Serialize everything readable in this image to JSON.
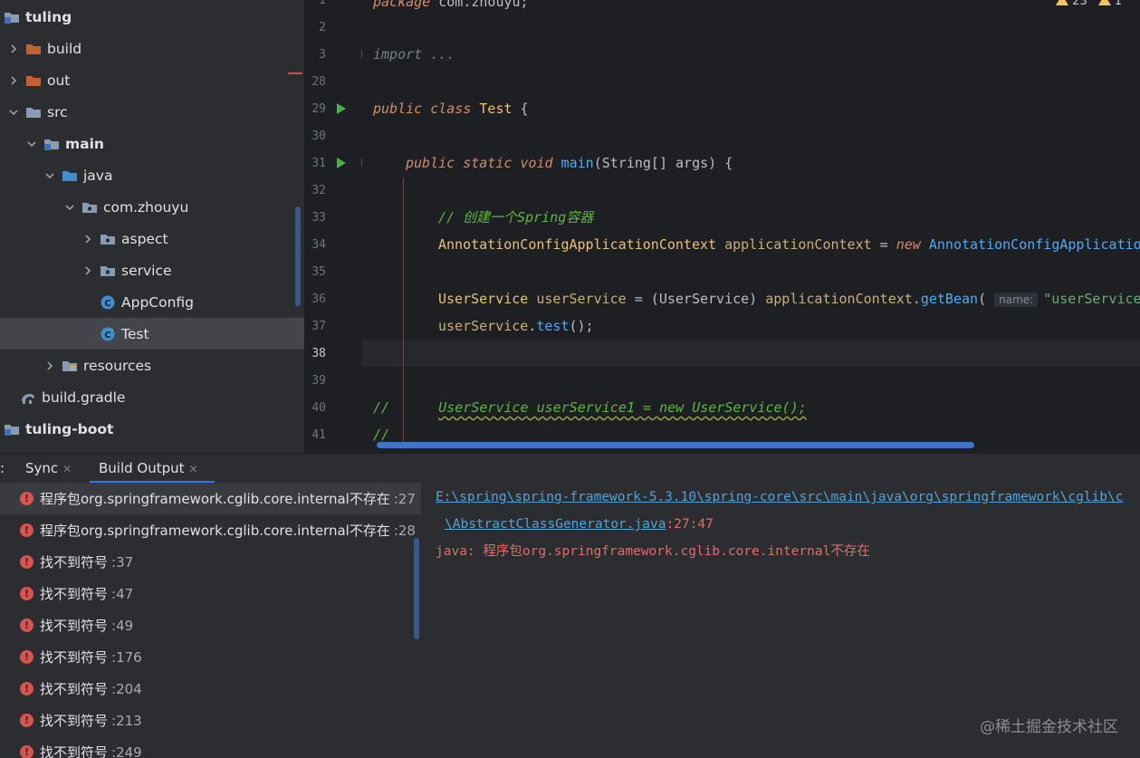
{
  "project_tree": {
    "items": [
      {
        "label": "tuling",
        "icon": "module-folder-icon"
      },
      {
        "label": "build",
        "icon": "excluded-folder-icon"
      },
      {
        "label": "out",
        "icon": "excluded-folder-icon"
      },
      {
        "label": "src",
        "icon": "folder-icon"
      },
      {
        "label": "main",
        "icon": "module-folder-icon"
      },
      {
        "label": "java",
        "icon": "source-folder-icon"
      },
      {
        "label": "com.zhouyu",
        "icon": "package-icon"
      },
      {
        "label": "aspect",
        "icon": "package-icon"
      },
      {
        "label": "service",
        "icon": "package-icon"
      },
      {
        "label": "AppConfig",
        "icon": "java-class-icon"
      },
      {
        "label": "Test",
        "icon": "java-class-icon"
      },
      {
        "label": "resources",
        "icon": "resources-folder-icon"
      },
      {
        "label": "build.gradle",
        "icon": "gradle-icon"
      },
      {
        "label": "tuling-boot",
        "icon": "module-folder-icon"
      }
    ]
  },
  "editor": {
    "line_numbers": [
      "1",
      "2",
      "3",
      "28",
      "29",
      "30",
      "31",
      "32",
      "33",
      "34",
      "35",
      "36",
      "37",
      "38",
      "39",
      "40",
      "41"
    ],
    "warnings": {
      "warning_count": "23",
      "weak_warning_count": "1"
    },
    "code": {
      "l1_kw": "package",
      "l1_rest": " com.zhouyu;",
      "l3_import": "import ...",
      "l29_kw1": "public",
      "l29_kw2": "class",
      "l29_cls": "Test",
      "l29_rest": " {",
      "l31_kw1": "public",
      "l31_kw2": "static",
      "l31_kw3": "void",
      "l31_fn": "main",
      "l31_rest": "(String[] args) {",
      "l33_comment": "// 创建一个Spring容器",
      "l34_cls": "AnnotationConfigApplicationContext",
      "l34_var": "applicationContext",
      "l34_eq": " = ",
      "l34_new": "new",
      "l34_cls2": "AnnotationConfigApplicatio",
      "l36_cls": "UserService",
      "l36_var": "userService",
      "l36_cast": " = (UserService) ",
      "l36_ctx": "applicationContext",
      "l36_dot": ".",
      "l36_fn": "getBean",
      "l36_paren": "(",
      "l36_hint": "name:",
      "l36_str": "\"userService\"",
      "l37_var": "userService",
      "l37_dot": ".",
      "l37_fn": "test",
      "l37_rest": "();",
      "l40_slashes": "//",
      "l40_code": "UserService userService1 = new UserService();",
      "l41_slashes": "//"
    }
  },
  "tool_window": {
    "tabs": [
      {
        "label": "Sync"
      },
      {
        "label": "Build Output"
      }
    ],
    "left_colon": ":"
  },
  "build_output": {
    "errors": [
      {
        "msg": "程序包org.springframework.cglib.core.internal不存在",
        "line": ":27"
      },
      {
        "msg": "程序包org.springframework.cglib.core.internal不存在",
        "line": ":28"
      },
      {
        "msg": "找不到符号",
        "line": ":37"
      },
      {
        "msg": "找不到符号",
        "line": ":47"
      },
      {
        "msg": "找不到符号",
        "line": ":49"
      },
      {
        "msg": "找不到符号",
        "line": ":176"
      },
      {
        "msg": "找不到符号",
        "line": ":204"
      },
      {
        "msg": "找不到符号",
        "line": ":213"
      },
      {
        "msg": "找不到符号",
        "line": ":249"
      }
    ],
    "detail": {
      "path": "E:\\spring\\spring-framework-5.3.10\\spring-core\\src\\main\\java\\org\\springframework\\cglib\\c",
      "file": "\\AbstractClassGenerator.java",
      "position": ":27:47",
      "message": "java: 程序包org.springframework.cglib.core.internal不存在"
    }
  },
  "watermark": "@稀土掘金技术社区",
  "colors": {
    "accent": "#3574f0",
    "error": "#d9534f",
    "link": "#54a3d6"
  }
}
